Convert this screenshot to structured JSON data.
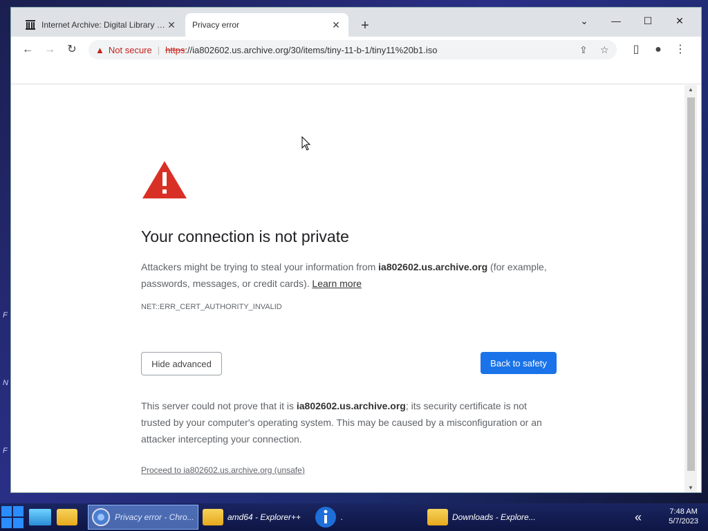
{
  "tabs": [
    {
      "title": "Internet Archive: Digital Library of Free & Borrowable Books",
      "icon": "archive-icon"
    },
    {
      "title": "Privacy error",
      "icon": "none"
    }
  ],
  "window_controls": {
    "tab_search": "⌄",
    "minimize": "—",
    "maximize": "☐",
    "close": "✕"
  },
  "toolbar": {
    "back": "←",
    "forward": "→",
    "reload": "↻",
    "security_label": "Not secure",
    "url_scheme": "https",
    "url_rest": "://ia802602.us.archive.org/30/items/tiny-11-b-1/tiny11%20b1.iso"
  },
  "page": {
    "heading": "Your connection is not private",
    "desc_before": "Attackers might be trying to steal your information from ",
    "desc_host": "ia802602.us.archive.org",
    "desc_after": " (for example, passwords, messages, or credit cards). ",
    "learn_more": "Learn more",
    "error_code": "NET::ERR_CERT_AUTHORITY_INVALID",
    "hide_advanced": "Hide advanced",
    "back_to_safety": "Back to safety",
    "explain_before": "This server could not prove that it is ",
    "explain_host": "ia802602.us.archive.org",
    "explain_after": "; its security certificate is not trusted by your computer's operating system. This may be caused by a misconfiguration or an attacker intercepting your connection.",
    "proceed_link": "Proceed to ia802602.us.archive.org (unsafe)"
  },
  "taskbar": {
    "items": [
      {
        "label": "Privacy error - Chro..."
      },
      {
        "label": "amd64 - Explorer++"
      },
      {
        "label": "."
      },
      {
        "label": "Downloads - Explore..."
      }
    ],
    "chevron": "«",
    "time": "7:48 AM",
    "date": "5/7/2023"
  },
  "colors": {
    "accent": "#1a73e8",
    "danger": "#d93025"
  }
}
